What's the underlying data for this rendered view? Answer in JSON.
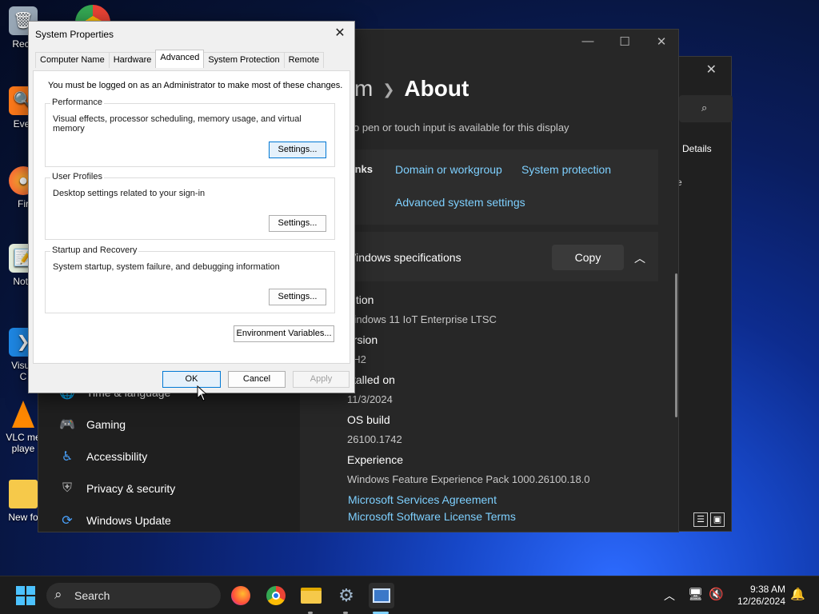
{
  "desktop": {
    "icons": [
      {
        "label": "Recy",
        "icon": "recycle-bin-icon"
      },
      {
        "label": "Ever",
        "icon": "everything-icon"
      },
      {
        "label": "Fir",
        "icon": "firefox-icon"
      },
      {
        "label": "Note",
        "icon": "notepad-icon"
      },
      {
        "label": "Visua",
        "label2": "C",
        "icon": "vscode-icon"
      },
      {
        "label": "VLC me",
        "label2": "playe",
        "icon": "vlc-icon"
      },
      {
        "label": "New fo",
        "icon": "folder-icon"
      }
    ]
  },
  "explorer": {
    "close": "✕",
    "details_label": "Details",
    "column_fragment": "e"
  },
  "settings": {
    "breadcrumb_prefix": "m",
    "breadcrumb_current": "About",
    "pen_touch_text": "o pen or touch input is available for this display",
    "related_links_label": "inks",
    "links": [
      "Domain or workgroup",
      "System protection",
      "Advanced system settings"
    ],
    "win_specs_title": "Vindows specifications",
    "copy_label": "Copy",
    "specs": [
      {
        "label": "dition",
        "value": "Vindows 11 IoT Enterprise LTSC"
      },
      {
        "label": "ersion",
        "value": "4H2"
      },
      {
        "label": "stalled on",
        "value": "11/3/2024"
      },
      {
        "label": "OS build",
        "value": "26100.1742"
      },
      {
        "label": "Experience",
        "value": "Windows Feature Experience Pack 1000.26100.18.0"
      }
    ],
    "agreements": [
      "Microsoft Services Agreement",
      "Microsoft Software License Terms"
    ],
    "nav": [
      {
        "label": "Time & language",
        "icon": "globe-clock-icon"
      },
      {
        "label": "Gaming",
        "icon": "gamepad-icon"
      },
      {
        "label": "Accessibility",
        "icon": "accessibility-icon"
      },
      {
        "label": "Privacy & security",
        "icon": "shield-icon"
      },
      {
        "label": "Windows Update",
        "icon": "windows-update-icon"
      }
    ]
  },
  "dialog": {
    "title": "System Properties",
    "tabs": [
      "Computer Name",
      "Hardware",
      "Advanced",
      "System Protection",
      "Remote"
    ],
    "active_tab": "Advanced",
    "admin_note": "You must be logged on as an Administrator to make most of these changes.",
    "groups": [
      {
        "title": "Performance",
        "desc": "Visual effects, processor scheduling, memory usage, and virtual memory",
        "button": "Settings..."
      },
      {
        "title": "User Profiles",
        "desc": "Desktop settings related to your sign-in",
        "button": "Settings..."
      },
      {
        "title": "Startup and Recovery",
        "desc": "System startup, system failure, and debugging information",
        "button": "Settings..."
      }
    ],
    "env_button": "Environment Variables...",
    "ok": "OK",
    "cancel": "Cancel",
    "apply": "Apply"
  },
  "taskbar": {
    "search_label": "Search",
    "time": "9:38 AM",
    "date": "12/26/2024",
    "apps": [
      "firefox-icon",
      "chrome-icon",
      "file-explorer-icon",
      "settings-icon",
      "system-properties-icon"
    ]
  }
}
